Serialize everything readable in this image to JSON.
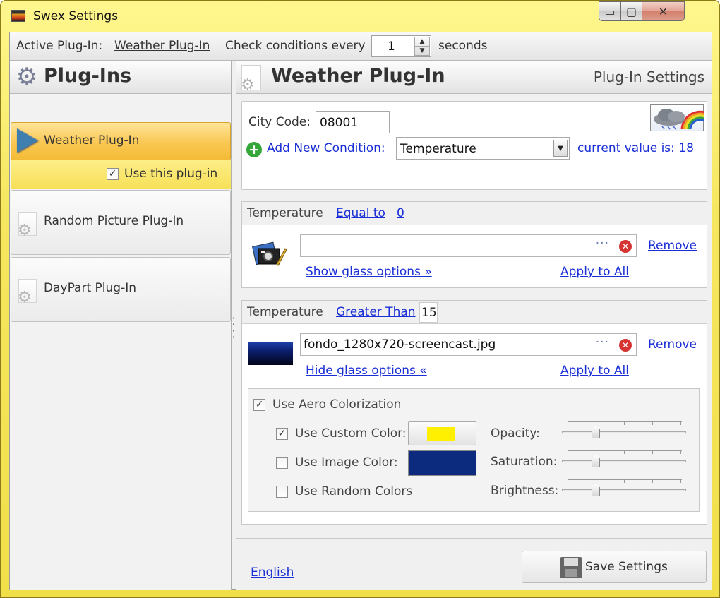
{
  "window": {
    "title": "Swex Settings",
    "minimize": "▭",
    "maximize": "▢",
    "close": "✕"
  },
  "topbar": {
    "active_label": "Active Plug-In:",
    "active_value": "Weather Plug-In",
    "check_label": "Check conditions every",
    "interval": "1",
    "unit": "seconds"
  },
  "left": {
    "title": "Plug-Ins",
    "plugins": [
      {
        "label": "Weather Plug-In",
        "use_label": "Use this plug-in",
        "checked": true
      },
      {
        "label": "Random Picture Plug-In"
      },
      {
        "label": "DayPart Plug-In"
      }
    ]
  },
  "right": {
    "title": "Weather Plug-In",
    "subtitle": "Plug-In Settings",
    "city_label": "City Code:",
    "city_value": "08001",
    "add_condition": "Add New Condition:",
    "condition_select": "Temperature",
    "current_value": "current value is: 18",
    "rules": [
      {
        "field": "Temperature",
        "operator": "Equal to",
        "value": "0",
        "file": "",
        "glass_link": "Show glass options »",
        "remove": "Remove",
        "apply": "Apply to All"
      },
      {
        "field": "Temperature",
        "operator": "Greater Than",
        "value": "15",
        "file": "fondo_1280x720-screencast.jpg",
        "glass_link": "Hide glass options «",
        "remove": "Remove",
        "apply": "Apply to All"
      }
    ],
    "glass": {
      "use_aero": "Use Aero Colorization",
      "use_custom": "Use Custom Color:",
      "use_image": "Use Image Color:",
      "use_random": "Use Random Colors",
      "opacity": "Opacity:",
      "saturation": "Saturation:",
      "brightness": "Brightness:",
      "custom_color": "#ffef00",
      "image_color": "#0c2a7e",
      "opacity_level": 0.2,
      "saturation_level": 0.2,
      "brightness_level": 0.2
    },
    "footer": {
      "language": "English",
      "save": "Save Settings"
    }
  }
}
